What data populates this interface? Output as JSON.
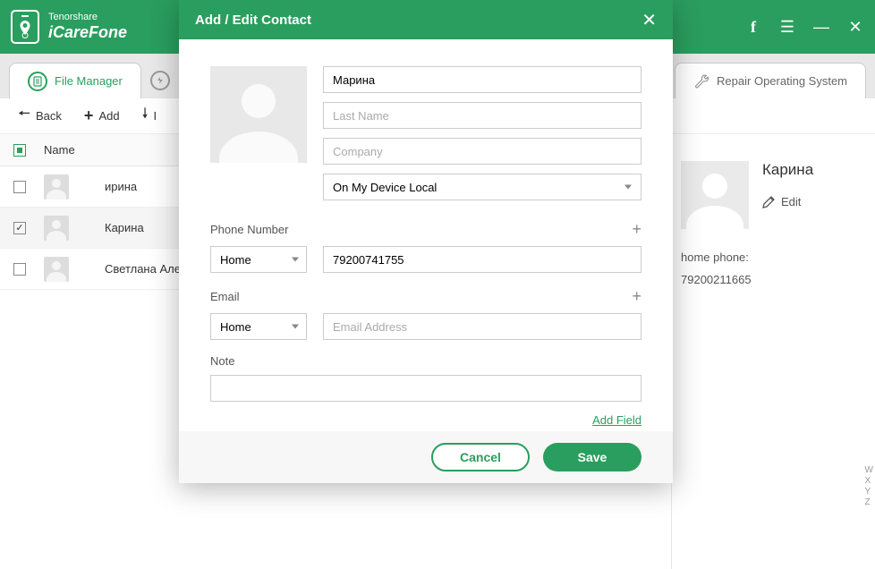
{
  "brand": {
    "sub": "Tenorshare",
    "main": "iCareFone"
  },
  "tabs": {
    "file_manager": "File Manager",
    "repair": "Repair Operating System"
  },
  "toolbar": {
    "back": "Back",
    "add": "Add",
    "import_prefix": "I"
  },
  "list": {
    "header_name": "Name",
    "rows": [
      {
        "name": "ирина",
        "checked": false
      },
      {
        "name": "Карина",
        "checked": true
      },
      {
        "name": "Светлана Александров",
        "checked": false
      }
    ]
  },
  "detail": {
    "name": "Карина",
    "edit": "Edit",
    "phone_label": "home phone:",
    "phone_value": "79200211665"
  },
  "alpha": [
    "W",
    "X",
    "Y",
    "Z"
  ],
  "modal": {
    "title": "Add / Edit Contact",
    "first_name": "Марина",
    "last_name_ph": "Last Name",
    "company_ph": "Company",
    "location": "On My Device Local",
    "phone_section": "Phone Number",
    "phone_type": "Home",
    "phone_value": "79200741755",
    "email_section": "Email",
    "email_type": "Home",
    "email_ph": "Email Address",
    "note_label": "Note",
    "add_field": "Add Field",
    "cancel": "Cancel",
    "save": "Save"
  }
}
